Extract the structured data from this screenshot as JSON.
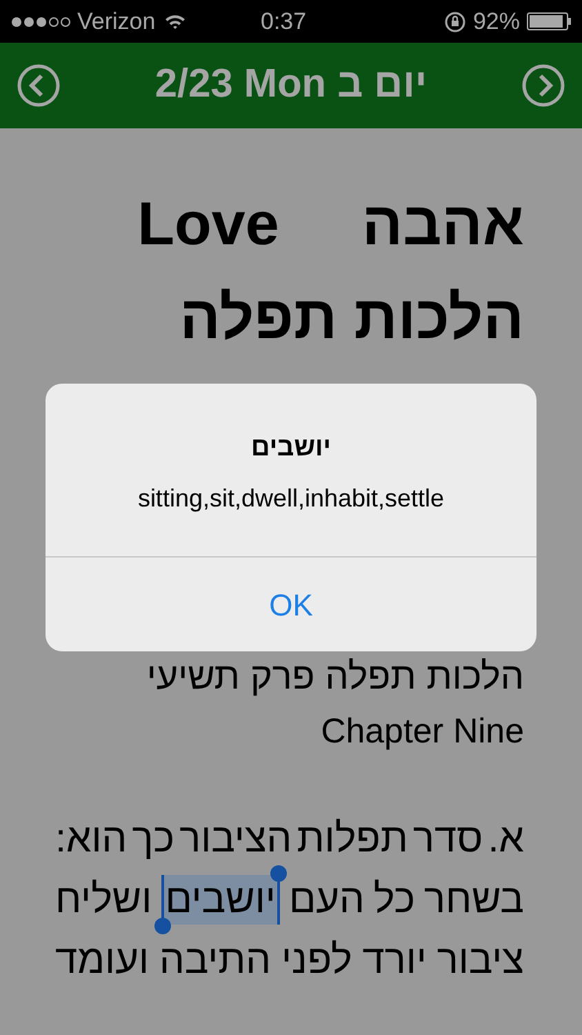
{
  "status_bar": {
    "carrier": "Verizon",
    "time": "0:37",
    "battery_text": "92%",
    "battery": {
      "level": 0.92
    }
  },
  "nav_bar": {
    "title": "2/23 Mon יום ב"
  },
  "content": {
    "title_hebrew": "אהבה",
    "title_english": "Love",
    "subtitle": "הלכות תפלה",
    "chapter_hebrew": "הלכות תפלה פרק תשיעי",
    "chapter_english": "Chapter Nine",
    "paragraph_lines": [
      {
        "words": [
          {
            "text": "א.",
            "selected": false
          },
          {
            "text": "סדר",
            "selected": false
          },
          {
            "text": "תפלות",
            "selected": false
          },
          {
            "text": "הציבור",
            "selected": false
          },
          {
            "text": "כך",
            "selected": false
          },
          {
            "text": "הוא:",
            "selected": false
          }
        ]
      },
      {
        "words": [
          {
            "text": "בשחר",
            "selected": false
          },
          {
            "text": "כל",
            "selected": false
          },
          {
            "text": "העם",
            "selected": false
          },
          {
            "text": "יושבים",
            "selected": true
          },
          {
            "text": "ושליח",
            "selected": false
          }
        ]
      },
      {
        "words": [
          {
            "text": "ציבור",
            "selected": false
          },
          {
            "text": "יורד",
            "selected": false
          },
          {
            "text": "לפני",
            "selected": false
          },
          {
            "text": "התיבה",
            "selected": false
          },
          {
            "text": "ועומד",
            "selected": false
          }
        ]
      }
    ]
  },
  "alert": {
    "title": "יושבים",
    "message": "sitting,sit,dwell,inhabit,settle",
    "buttons": [
      "OK"
    ]
  }
}
